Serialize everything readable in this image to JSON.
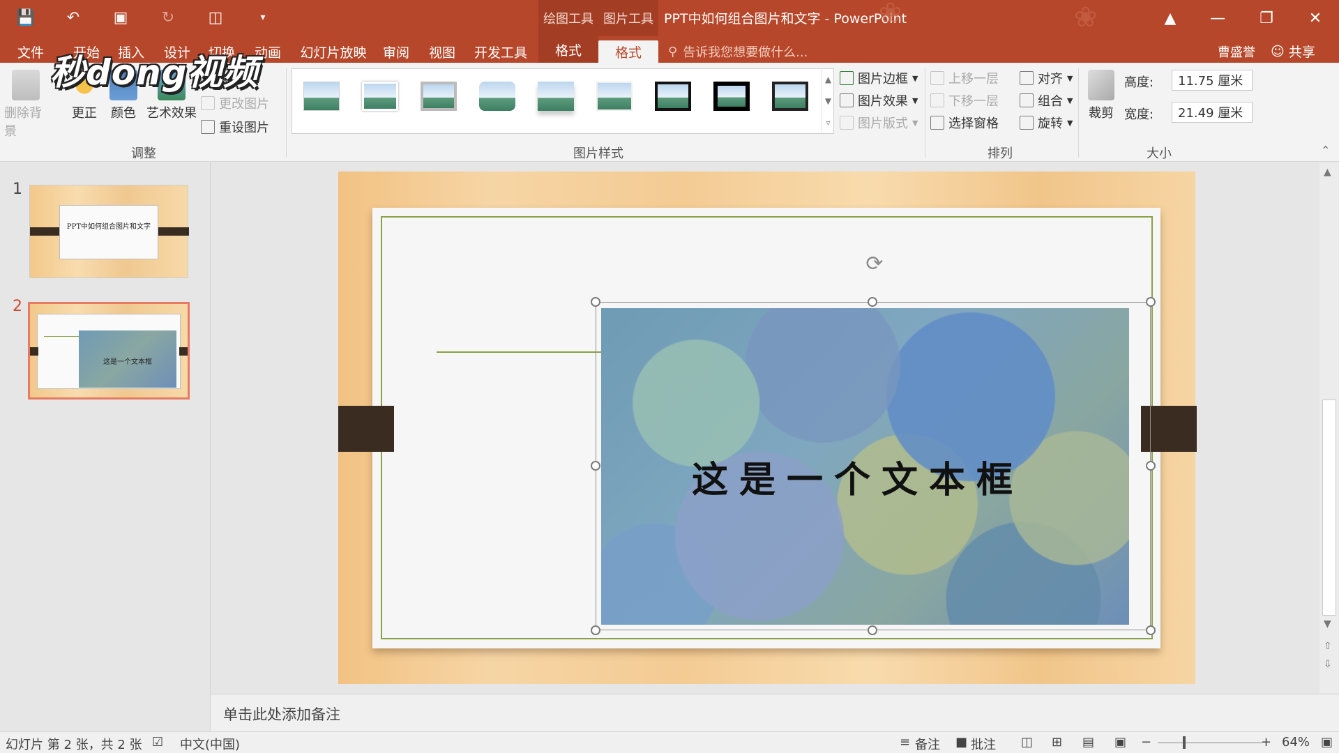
{
  "window": {
    "title": "PPT中如何组合图片和文字 - PowerPoint",
    "context_groups": [
      "绘图工具",
      "图片工具"
    ],
    "user": "曹盛誉",
    "share": "共享"
  },
  "tabs": [
    "文件",
    "开始",
    "插入",
    "设计",
    "切换",
    "动画",
    "幻灯片放映",
    "审阅",
    "视图",
    "开发工具",
    "格式",
    "格式"
  ],
  "tell_me": "告诉我您想要做什么...",
  "ribbon": {
    "adjust": {
      "remove_bg": "删除背景",
      "corrections": "更正",
      "color": "颜色",
      "artistic": "艺术效果",
      "compress": "图片",
      "change": "更改图片",
      "reset": "重设图片",
      "label": "调整"
    },
    "styles": {
      "label": "图片样式",
      "border": "图片边框",
      "effects": "图片效果",
      "layout": "图片版式"
    },
    "arrange": {
      "label": "排列",
      "forward": "上移一层",
      "backward": "下移一层",
      "pane": "选择窗格",
      "align": "对齐",
      "group": "组合",
      "rotate": "旋转"
    },
    "size": {
      "label": "大小",
      "crop": "裁剪",
      "height_label": "高度:",
      "height_value": "11.75 厘米",
      "width_label": "宽度:",
      "width_value": "21.49 厘米"
    }
  },
  "watermark": "秒dong视频",
  "slides": [
    {
      "num": "1",
      "text": "PPT中如何组合图片和文字"
    },
    {
      "num": "2",
      "text": "这是一个文本框"
    }
  ],
  "slide_text": "这是一个文本框",
  "notes_placeholder": "单击此处添加备注",
  "status": {
    "slide_info": "幻灯片 第 2 张，共 2 张",
    "language": "中文(中国)",
    "notes": "备注",
    "comments": "批注",
    "zoom": "64%"
  }
}
